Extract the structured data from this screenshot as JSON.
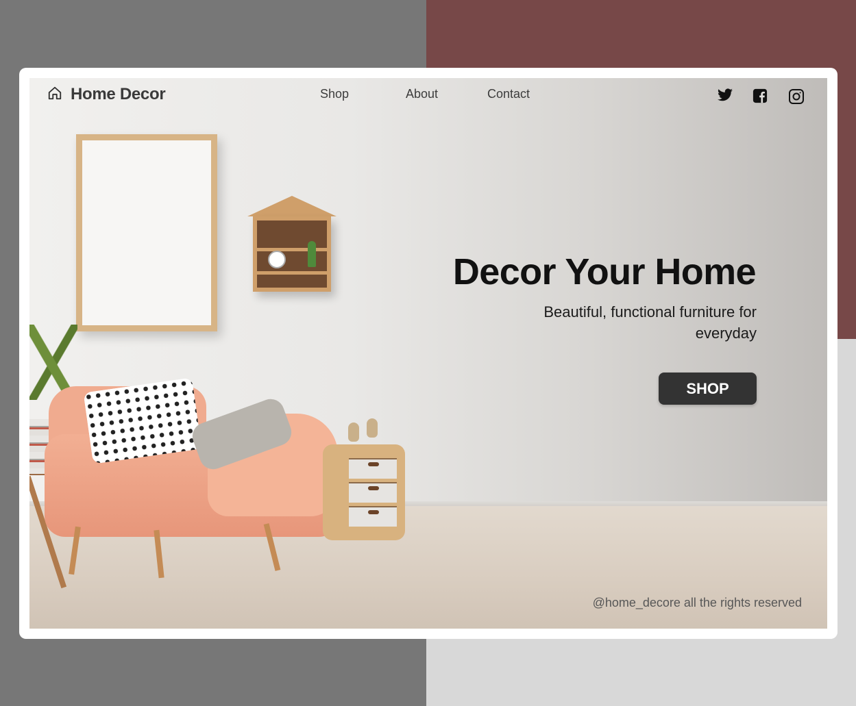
{
  "brand": {
    "name": "Home Decor",
    "icon": "home-icon"
  },
  "nav": {
    "links": [
      {
        "label": "Shop"
      },
      {
        "label": "About"
      },
      {
        "label": "Contact"
      }
    ]
  },
  "social": [
    {
      "icon": "twitter-icon"
    },
    {
      "icon": "facebook-icon"
    },
    {
      "icon": "instagram-icon"
    }
  ],
  "hero": {
    "headline": "Decor Your Home",
    "subline": "Beautiful, functional furniture for everyday",
    "cta_label": "SHOP"
  },
  "footer": {
    "text": "@home_decore all the rights reserved"
  },
  "colors": {
    "background_left": "#777777",
    "background_top_right": "#774848",
    "background_bottom_right": "#d8d8d8",
    "button": "#333333",
    "armchair": "#f0ab8f"
  }
}
